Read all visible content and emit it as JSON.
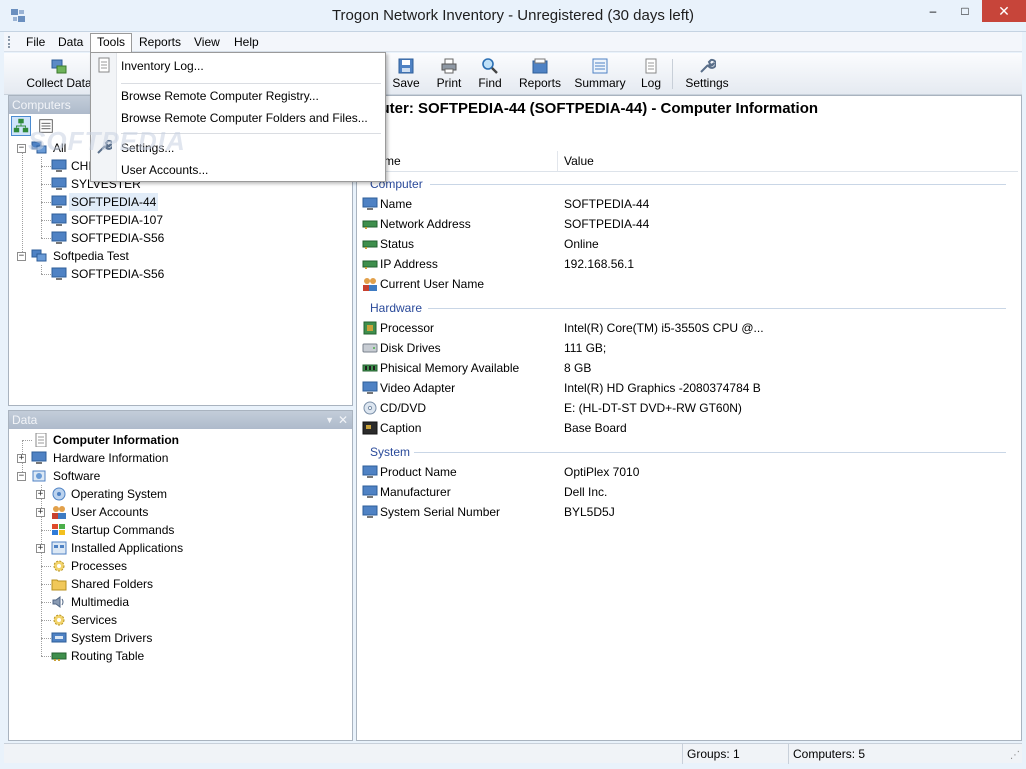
{
  "window": {
    "title": "Trogon Network Inventory - Unregistered (30 days left)",
    "min_glyph": "–",
    "max_glyph": "□",
    "close_glyph": "✕"
  },
  "menu": {
    "items": [
      "File",
      "Data",
      "Tools",
      "Reports",
      "View",
      "Help"
    ],
    "open_item": "Tools"
  },
  "tools_menu": {
    "items": [
      "Inventory Log...",
      "Browse Remote Computer Registry...",
      "Browse Remote Computer Folders and Files...",
      "Settings...",
      "User Accounts..."
    ]
  },
  "toolbar": {
    "buttons": [
      "Collect Data",
      "Save",
      "Print",
      "Find",
      "Reports",
      "Summary",
      "Log",
      "Settings"
    ]
  },
  "computers_panel": {
    "header": "Computers",
    "tree": [
      {
        "label": "All",
        "level": 0
      },
      {
        "label": "CHI",
        "level": 1
      },
      {
        "label": "SYLVESTER",
        "level": 1
      },
      {
        "label": "SOFTPEDIA-44",
        "level": 1,
        "selected": true
      },
      {
        "label": "SOFTPEDIA-107",
        "level": 1
      },
      {
        "label": "SOFTPEDIA-S56",
        "level": 1
      },
      {
        "label": "Softpedia Test",
        "level": 0
      },
      {
        "label": "SOFTPEDIA-S56",
        "level": 1
      }
    ]
  },
  "data_panel": {
    "header": "Data",
    "tree": [
      {
        "label": "Computer Information",
        "level": 0,
        "bold": true
      },
      {
        "label": "Hardware Information",
        "level": 0
      },
      {
        "label": "Software",
        "level": 0
      },
      {
        "label": "Operating System",
        "level": 1
      },
      {
        "label": "User Accounts",
        "level": 1
      },
      {
        "label": "Startup Commands",
        "level": 1
      },
      {
        "label": "Installed Applications",
        "level": 1
      },
      {
        "label": "Processes",
        "level": 1
      },
      {
        "label": "Shared Folders",
        "level": 1
      },
      {
        "label": "Multimedia",
        "level": 1
      },
      {
        "label": "Services",
        "level": 1
      },
      {
        "label": "System Drivers",
        "level": 1
      },
      {
        "label": "Routing Table",
        "level": 1
      }
    ]
  },
  "main": {
    "title": "mputer: SOFTPEDIA-44 (SOFTPEDIA-44) - Computer Information",
    "columns": [
      "me",
      "Value"
    ],
    "groups": [
      {
        "name": "Computer",
        "rows": [
          {
            "name": "Name",
            "value": "SOFTPEDIA-44"
          },
          {
            "name": "Network Address",
            "value": "SOFTPEDIA-44"
          },
          {
            "name": "Status",
            "value": "Online"
          },
          {
            "name": "IP Address",
            "value": "192.168.56.1"
          },
          {
            "name": "Current User Name",
            "value": ""
          }
        ]
      },
      {
        "name": "Hardware",
        "rows": [
          {
            "name": "Processor",
            "value": "Intel(R) Core(TM) i5-3550S CPU @..."
          },
          {
            "name": "Disk Drives",
            "value": "111 GB;"
          },
          {
            "name": "Phisical Memory Available",
            "value": "8 GB"
          },
          {
            "name": "Video Adapter",
            "value": "Intel(R) HD Graphics -2080374784 B"
          },
          {
            "name": "CD/DVD",
            "value": "E: (HL-DT-ST DVD+-RW GT60N)"
          },
          {
            "name": "Caption",
            "value": "Base Board"
          }
        ]
      },
      {
        "name": "System",
        "rows": [
          {
            "name": "Product Name",
            "value": "OptiPlex 7010"
          },
          {
            "name": "Manufacturer",
            "value": "Dell Inc."
          },
          {
            "name": "System Serial Number",
            "value": "BYL5D5J"
          }
        ]
      }
    ]
  },
  "status": {
    "groups": "Groups: 1",
    "computers": "Computers: 5"
  },
  "watermark": "SOFTPEDIA"
}
